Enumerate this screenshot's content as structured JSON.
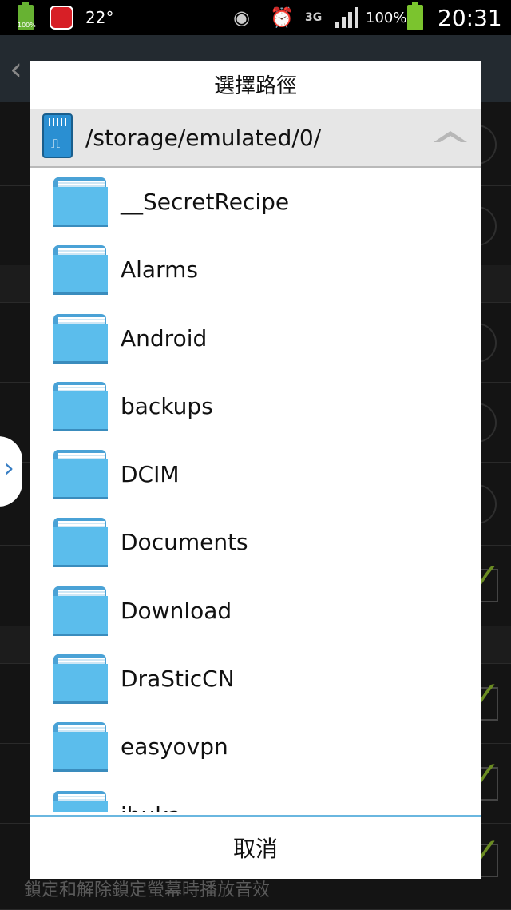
{
  "status_bar": {
    "battery_left_pct": "100%",
    "temperature": "22°",
    "network": "3G",
    "battery_pct": "100%",
    "time": "20:31"
  },
  "background": {
    "footer_text": "鎖定和解除鎖定螢幕時播放音效"
  },
  "dialog": {
    "title": "選擇路徑",
    "path": "/storage/emulated/0/",
    "folders": [
      "__SecretRecipe",
      "Alarms",
      "Android",
      "backups",
      "DCIM",
      "Documents",
      "Download",
      "DraSticCN",
      "easyovpn",
      "ibuka"
    ],
    "cancel_label": "取消"
  },
  "colors": {
    "folder_blue": "#5bbdec",
    "divider_blue": "#6ab7e0"
  }
}
